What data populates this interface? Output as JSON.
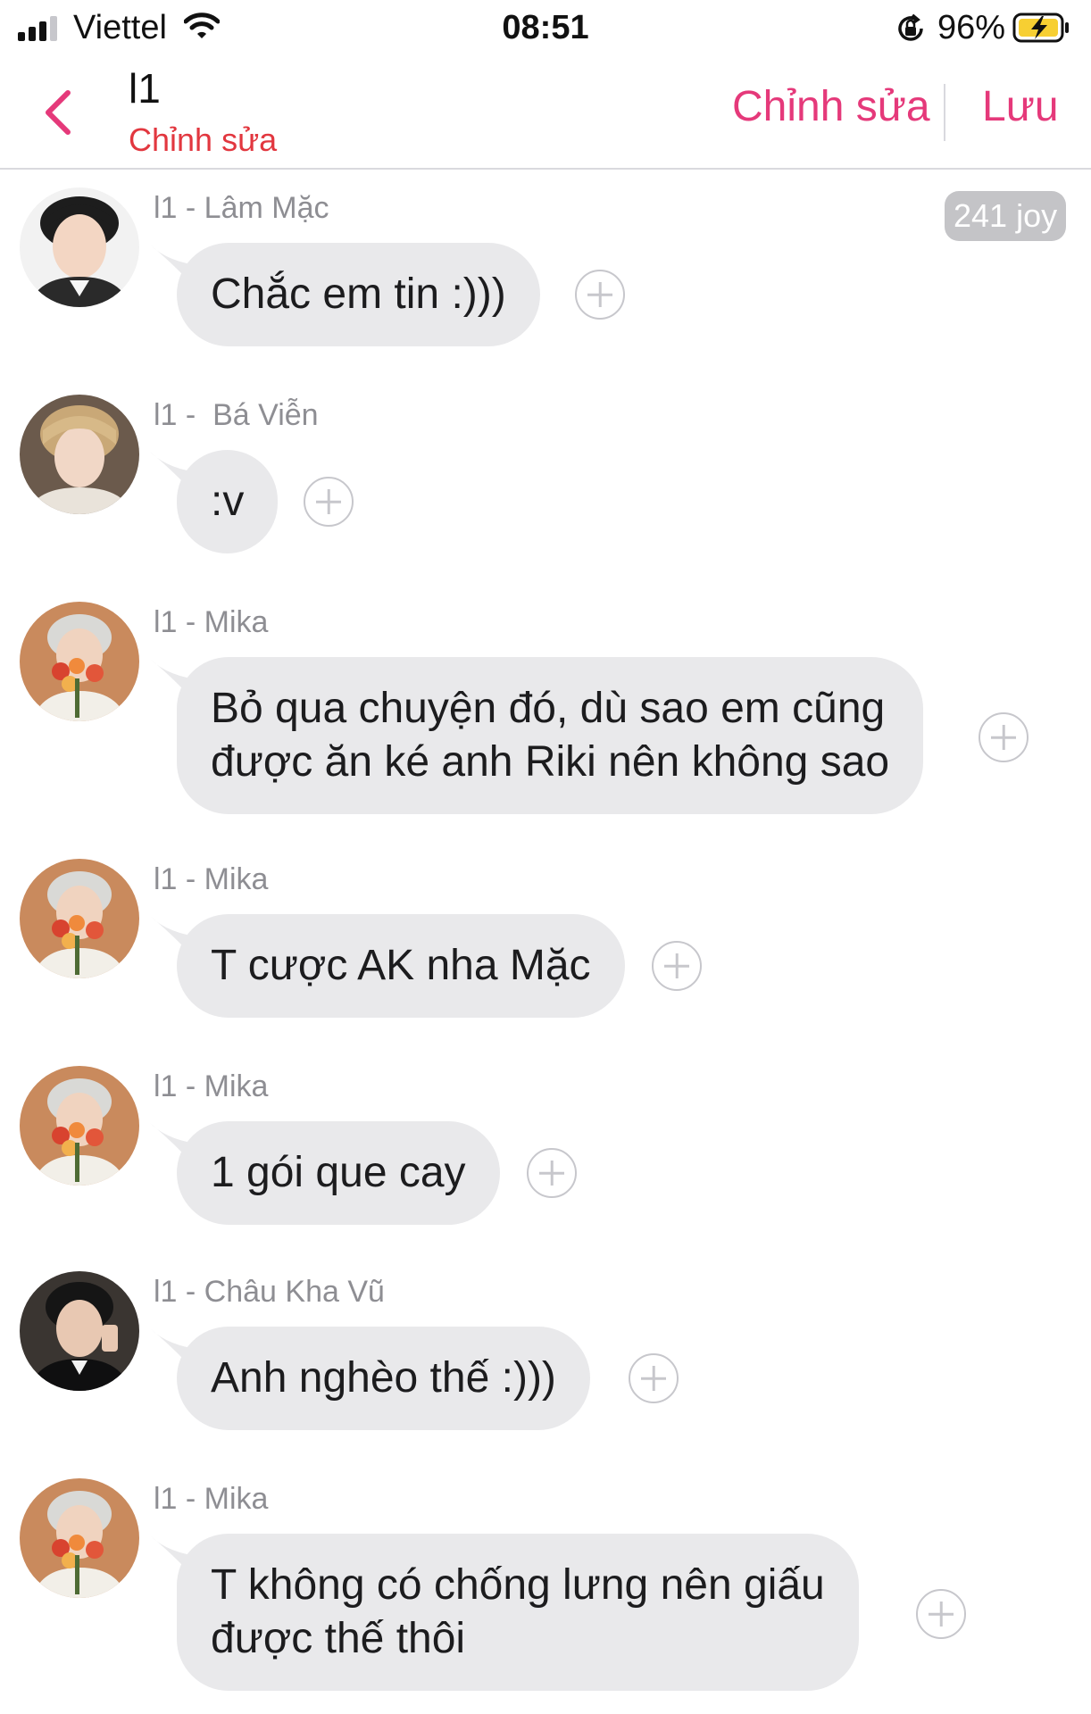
{
  "status_bar": {
    "carrier": "Viettel",
    "time": "08:51",
    "battery": "96%",
    "icons": [
      "signal-icon",
      "wifi-icon",
      "orientation-lock-icon",
      "battery-charging-icon"
    ]
  },
  "nav": {
    "back_icon": "chevron-left-icon",
    "title": "l1",
    "subtitle": "Chỉnh sửa",
    "edit_label": "Chỉnh sửa",
    "save_label": "Lưu"
  },
  "badge": {
    "text": "241 joy"
  },
  "colors": {
    "accent": "#e5397a",
    "subtitle": "#e2373f",
    "bubble": "#e9e9eb",
    "meta": "#8e8e93"
  },
  "messages": [
    {
      "sender": "l1 - Lâm Mặc",
      "lines": [
        "Chắc em tin :)))"
      ]
    },
    {
      "sender": "l1 -  Bá Viễn",
      "lines": [
        ":v"
      ]
    },
    {
      "sender": "l1 - Mika",
      "lines": [
        "Bỏ qua chuyện đó, dù sao em cũng",
        "được ăn ké anh Riki nên không sao"
      ]
    },
    {
      "sender": "l1 - Mika",
      "lines": [
        "T cược AK nha Mặc"
      ]
    },
    {
      "sender": "l1 - Mika",
      "lines": [
        "1 gói que cay"
      ]
    },
    {
      "sender": "l1 - Châu Kha Vũ",
      "lines": [
        "Anh nghèo thế :)))"
      ]
    },
    {
      "sender": "l1 - Mika",
      "lines": [
        "T không có chống lưng nên giấu",
        "được thế thôi"
      ]
    }
  ]
}
